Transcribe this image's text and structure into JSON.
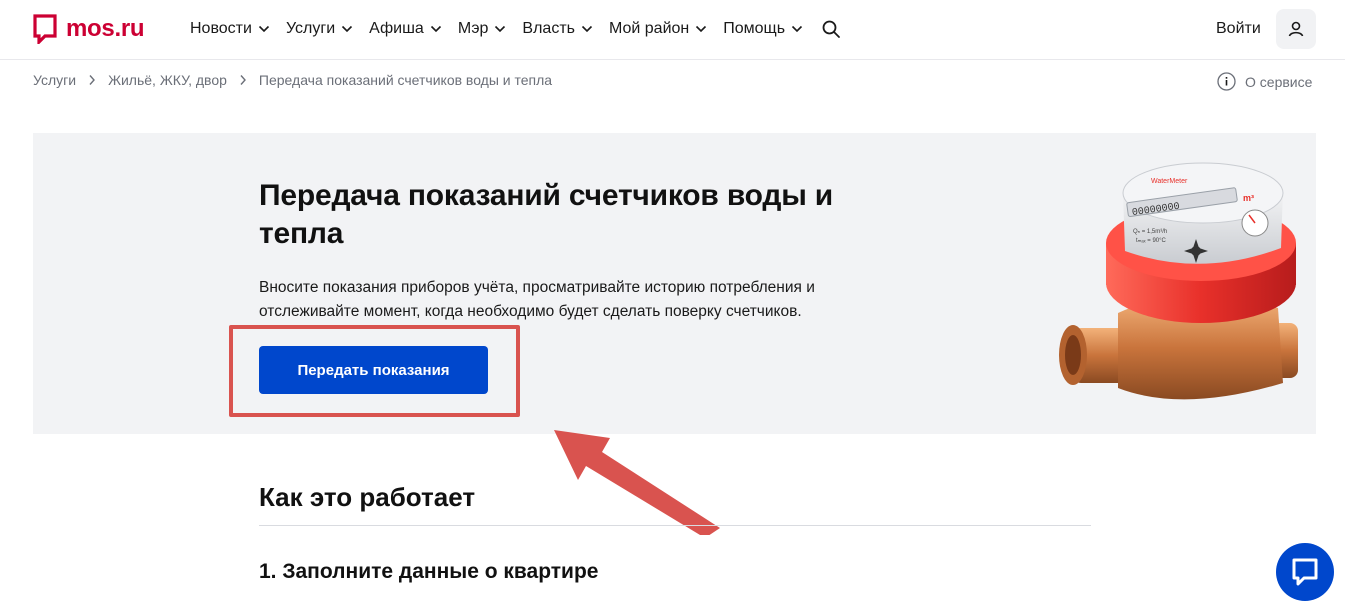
{
  "header": {
    "logo_text": "mos.ru",
    "nav": [
      {
        "label": "Новости"
      },
      {
        "label": "Услуги"
      },
      {
        "label": "Афиша"
      },
      {
        "label": "Мэр"
      },
      {
        "label": "Власть"
      },
      {
        "label": "Мой район"
      },
      {
        "label": "Помощь"
      }
    ],
    "login_label": "Войти"
  },
  "breadcrumb": {
    "items": [
      "Услуги",
      "Жильё, ЖКУ, двор",
      "Передача показаний счетчиков воды и тепла"
    ],
    "about_label": "О сервисе"
  },
  "hero": {
    "title": "Передача показаний счетчиков воды и тепла",
    "description": "Вносите показания приборов учёта, просматривайте историю потребления и отслеживайте момент, когда необходимо будет сделать поверку счетчиков.",
    "button_label": "Передать показания",
    "meter": {
      "brand": "WaterMeter",
      "unit": "m³",
      "spec1": "Qₙ = 1,5m³/h",
      "spec2": "tₘₐₓ = 90°C",
      "digits": "00000000"
    }
  },
  "how": {
    "title": "Как это работает",
    "steps": [
      {
        "label": "1. Заполните данные о квартире"
      }
    ]
  },
  "colors": {
    "brand": "#cc0033",
    "accent": "#0047cc",
    "annotation": "#d9534f",
    "hero_bg": "#f2f3f5"
  },
  "icons": [
    "speech-bubble-logo-icon",
    "chevron-down-icon",
    "search-icon",
    "user-icon",
    "chevron-right-icon",
    "info-icon",
    "chat-icon"
  ]
}
